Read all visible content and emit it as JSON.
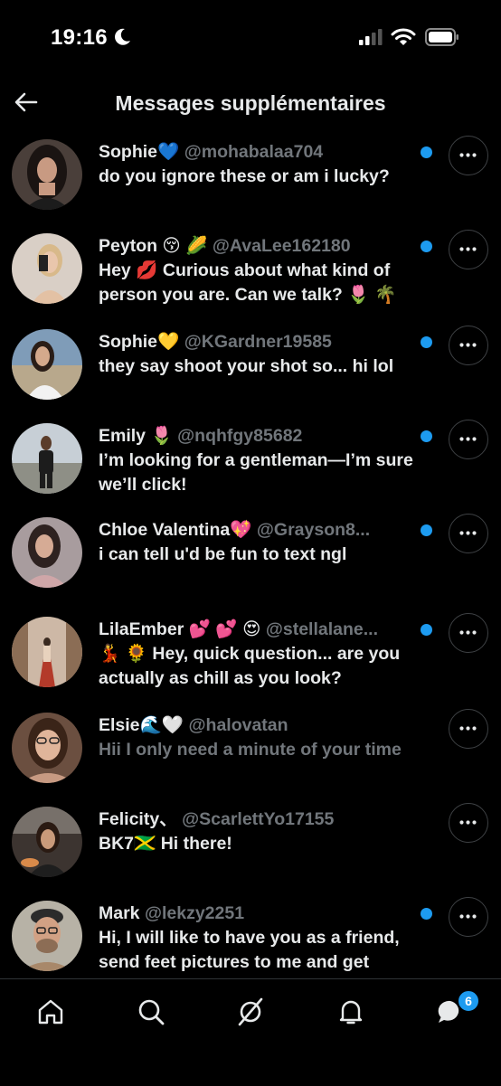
{
  "status_bar": {
    "time": "19:16"
  },
  "header": {
    "title": "Messages supplémentaires"
  },
  "messages": [
    {
      "name": "Sophie💙",
      "handle": "@mohabalaa704",
      "preview": "do you ignore these or am i lucky?",
      "unread": true
    },
    {
      "name": "Peyton 😚 🌽",
      "handle": "@AvaLee162180",
      "preview": "Hey 💋 Curious about what kind of person you are. Can we talk? 🌷 🌴",
      "unread": true
    },
    {
      "name": "Sophie💛",
      "handle": "@KGardner19585",
      "preview": "they say shoot your shot so... hi lol",
      "unread": true
    },
    {
      "name": "Emily 🌷",
      "handle": "@nqhfgy85682",
      "preview": "I’m looking for a gentleman—I’m sure we’ll click!",
      "unread": true
    },
    {
      "name": "Chloe Valentina💖",
      "handle": "@Grayson8...",
      "preview": "i can tell u'd be fun to text ngl",
      "unread": true
    },
    {
      "name": "LilaEmber 💕 💕 😍",
      "handle": "@stellalane...",
      "preview": "💃 🌻 Hey, quick question... are you actually as chill as you look?",
      "unread": true
    },
    {
      "name": "Elsie🌊🤍",
      "handle": "@halovatan",
      "preview": "Hii I only need a minute of your time",
      "unread": false
    },
    {
      "name": "Felicity、",
      "handle": "@ScarlettYo17155",
      "preview": "BK7🇯🇲 Hi there!",
      "unread": false
    },
    {
      "name": "Mark",
      "handle": "@lekzy2251",
      "preview": "Hi, I will like to have you as a friend, send feet pictures to me and get",
      "unread": true
    }
  ],
  "tab_bar": {
    "badge_count": "6"
  },
  "colors": {
    "accent": "#1d9bf0",
    "muted": "#71767b",
    "text": "#e7e9ea",
    "background": "#000000"
  }
}
